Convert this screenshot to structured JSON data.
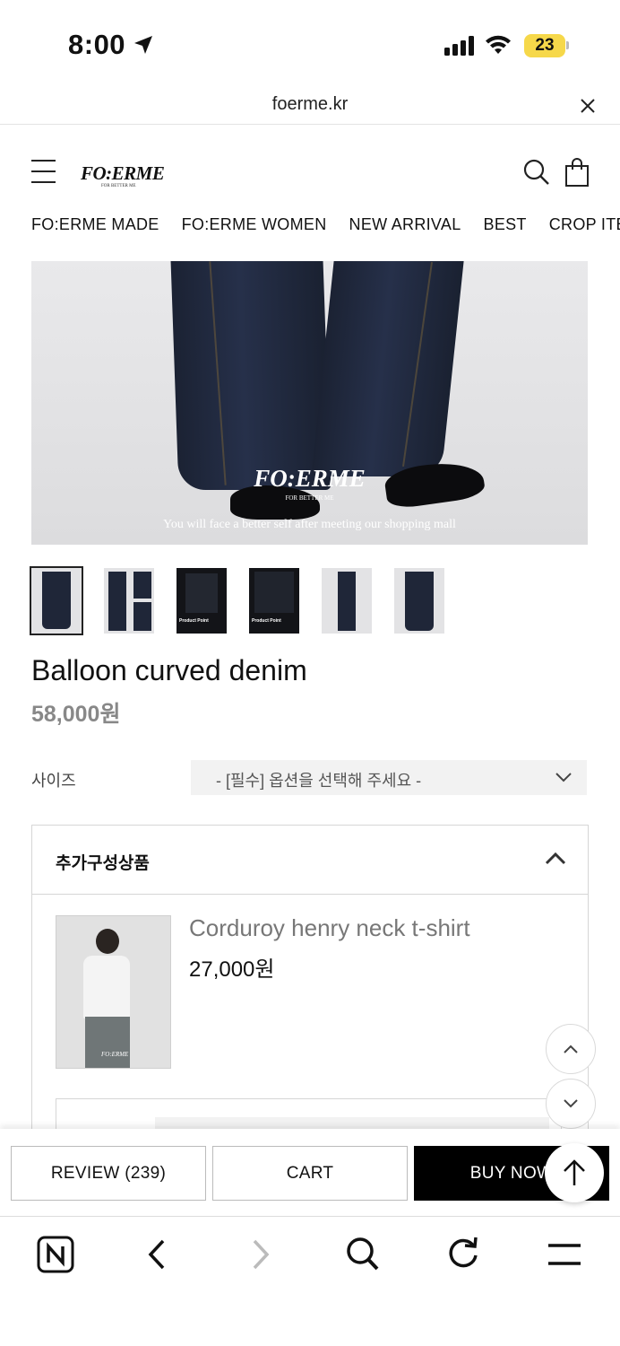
{
  "status_bar": {
    "time": "8:00",
    "battery": "23"
  },
  "browser": {
    "url": "foerme.kr"
  },
  "site": {
    "logo": "FO:ERME",
    "logo_tagline": "FOR BETTER ME",
    "categories": [
      "FO:ERME MADE",
      "FO:ERME WOMEN",
      "NEW ARRIVAL",
      "BEST",
      "CROP ITEM"
    ]
  },
  "hero": {
    "logo": "FO:ERME",
    "tagline": "FOR BETTER ME",
    "caption": "You will face a better self after meeting our shopping mall"
  },
  "thumbnails": [
    {
      "label": ""
    },
    {
      "label": ""
    },
    {
      "label": "Product Point"
    },
    {
      "label": "Product Point"
    },
    {
      "label": ""
    },
    {
      "label": ""
    }
  ],
  "product": {
    "title": "Balloon curved denim",
    "price": "58,000원",
    "size_label": "사이즈",
    "size_placeholder": "- [필수] 옵션을 선택해 주세요 -"
  },
  "addon": {
    "heading": "추가구성상품",
    "item_name": "Corduroy henry neck t-shirt",
    "item_price": "27,000원",
    "item_logo": "FO:ERME"
  },
  "actions": {
    "review": "REVIEW (239)",
    "cart": "CART",
    "buy": "BUY NOW"
  },
  "colors": {
    "accent": "#000000",
    "price_gray": "#888888",
    "battery": "#f6d84a"
  }
}
